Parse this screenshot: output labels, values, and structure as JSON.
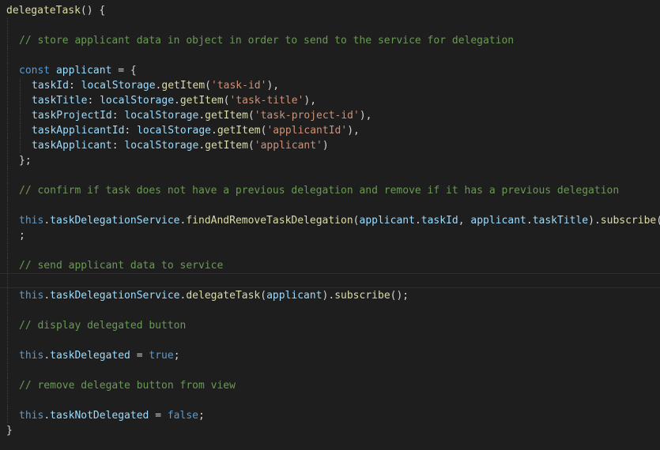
{
  "editor": {
    "colors": {
      "background": "#1e1e1e",
      "function": "#dcdcaa",
      "keyword": "#569cd6",
      "variable": "#9cdcfe",
      "string": "#ce9178",
      "comment": "#6a9955",
      "punctuation": "#d4d4d4"
    },
    "lines": [
      {
        "indent": 0,
        "tokens": [
          [
            "fn",
            "delegateTask"
          ],
          [
            "pn",
            "() {"
          ]
        ]
      },
      {
        "indent": 1,
        "tokens": []
      },
      {
        "indent": 1,
        "tokens": [
          [
            "cm",
            "// store applicant data in object in order to send to the service for delegation"
          ]
        ]
      },
      {
        "indent": 1,
        "tokens": []
      },
      {
        "indent": 1,
        "tokens": [
          [
            "kw",
            "const "
          ],
          [
            "var",
            "applicant"
          ],
          [
            "pn",
            " = {"
          ]
        ]
      },
      {
        "indent": 2,
        "tokens": [
          [
            "var",
            "taskId"
          ],
          [
            "pn",
            ": "
          ],
          [
            "var",
            "localStorage"
          ],
          [
            "pn",
            "."
          ],
          [
            "fn",
            "getItem"
          ],
          [
            "pn",
            "("
          ],
          [
            "str",
            "'task-id'"
          ],
          [
            "pn",
            "),"
          ]
        ]
      },
      {
        "indent": 2,
        "tokens": [
          [
            "var",
            "taskTitle"
          ],
          [
            "pn",
            ": "
          ],
          [
            "var",
            "localStorage"
          ],
          [
            "pn",
            "."
          ],
          [
            "fn",
            "getItem"
          ],
          [
            "pn",
            "("
          ],
          [
            "str",
            "'task-title'"
          ],
          [
            "pn",
            "),"
          ]
        ]
      },
      {
        "indent": 2,
        "tokens": [
          [
            "var",
            "taskProjectId"
          ],
          [
            "pn",
            ": "
          ],
          [
            "var",
            "localStorage"
          ],
          [
            "pn",
            "."
          ],
          [
            "fn",
            "getItem"
          ],
          [
            "pn",
            "("
          ],
          [
            "str",
            "'task-project-id'"
          ],
          [
            "pn",
            "),"
          ]
        ]
      },
      {
        "indent": 2,
        "tokens": [
          [
            "var",
            "taskApplicantId"
          ],
          [
            "pn",
            ": "
          ],
          [
            "var",
            "localStorage"
          ],
          [
            "pn",
            "."
          ],
          [
            "fn",
            "getItem"
          ],
          [
            "pn",
            "("
          ],
          [
            "str",
            "'applicantId'"
          ],
          [
            "pn",
            "),"
          ]
        ]
      },
      {
        "indent": 2,
        "tokens": [
          [
            "var",
            "taskApplicant"
          ],
          [
            "pn",
            ": "
          ],
          [
            "var",
            "localStorage"
          ],
          [
            "pn",
            "."
          ],
          [
            "fn",
            "getItem"
          ],
          [
            "pn",
            "("
          ],
          [
            "str",
            "'applicant'"
          ],
          [
            "pn",
            ")"
          ]
        ]
      },
      {
        "indent": 1,
        "tokens": [
          [
            "pn",
            "};"
          ]
        ]
      },
      {
        "indent": 1,
        "tokens": []
      },
      {
        "indent": 1,
        "tokens": [
          [
            "cm",
            "// confirm if task does not have a previous delegation and remove if it has a previous delegation"
          ]
        ]
      },
      {
        "indent": 1,
        "tokens": []
      },
      {
        "indent": 1,
        "tokens": [
          [
            "kw",
            "this"
          ],
          [
            "pn",
            "."
          ],
          [
            "var",
            "taskDelegationService"
          ],
          [
            "pn",
            "."
          ],
          [
            "fn",
            "findAndRemoveTaskDelegation"
          ],
          [
            "pn",
            "("
          ],
          [
            "var",
            "applicant"
          ],
          [
            "pn",
            "."
          ],
          [
            "var",
            "taskId"
          ],
          [
            "pn",
            ", "
          ],
          [
            "var",
            "applicant"
          ],
          [
            "pn",
            "."
          ],
          [
            "var",
            "taskTitle"
          ],
          [
            "pn",
            ")."
          ],
          [
            "fn",
            "subscribe"
          ],
          [
            "pn",
            "()"
          ]
        ]
      },
      {
        "indent": 1,
        "tokens": [
          [
            "pn",
            ";"
          ]
        ]
      },
      {
        "indent": 1,
        "tokens": []
      },
      {
        "indent": 1,
        "tokens": [
          [
            "cm",
            "// send applicant data to service"
          ]
        ]
      },
      {
        "indent": 1,
        "tokens": [],
        "current": true
      },
      {
        "indent": 1,
        "tokens": [
          [
            "kw",
            "this"
          ],
          [
            "pn",
            "."
          ],
          [
            "var",
            "taskDelegationService"
          ],
          [
            "pn",
            "."
          ],
          [
            "fn",
            "delegateTask"
          ],
          [
            "pn",
            "("
          ],
          [
            "var",
            "applicant"
          ],
          [
            "pn",
            ")."
          ],
          [
            "fn",
            "subscribe"
          ],
          [
            "pn",
            "();"
          ]
        ]
      },
      {
        "indent": 1,
        "tokens": []
      },
      {
        "indent": 1,
        "tokens": [
          [
            "cm",
            "// display delegated button"
          ]
        ]
      },
      {
        "indent": 1,
        "tokens": []
      },
      {
        "indent": 1,
        "tokens": [
          [
            "kw",
            "this"
          ],
          [
            "pn",
            "."
          ],
          [
            "var",
            "taskDelegated"
          ],
          [
            "pn",
            " = "
          ],
          [
            "kw",
            "true"
          ],
          [
            "pn",
            ";"
          ]
        ]
      },
      {
        "indent": 1,
        "tokens": []
      },
      {
        "indent": 1,
        "tokens": [
          [
            "cm",
            "// remove delegate button from view"
          ]
        ]
      },
      {
        "indent": 1,
        "tokens": []
      },
      {
        "indent": 1,
        "tokens": [
          [
            "kw",
            "this"
          ],
          [
            "pn",
            "."
          ],
          [
            "var",
            "taskNotDelegated"
          ],
          [
            "pn",
            " = "
          ],
          [
            "kw",
            "false"
          ],
          [
            "pn",
            ";"
          ]
        ]
      },
      {
        "indent": 0,
        "tokens": [
          [
            "pn",
            "}"
          ]
        ]
      }
    ]
  }
}
